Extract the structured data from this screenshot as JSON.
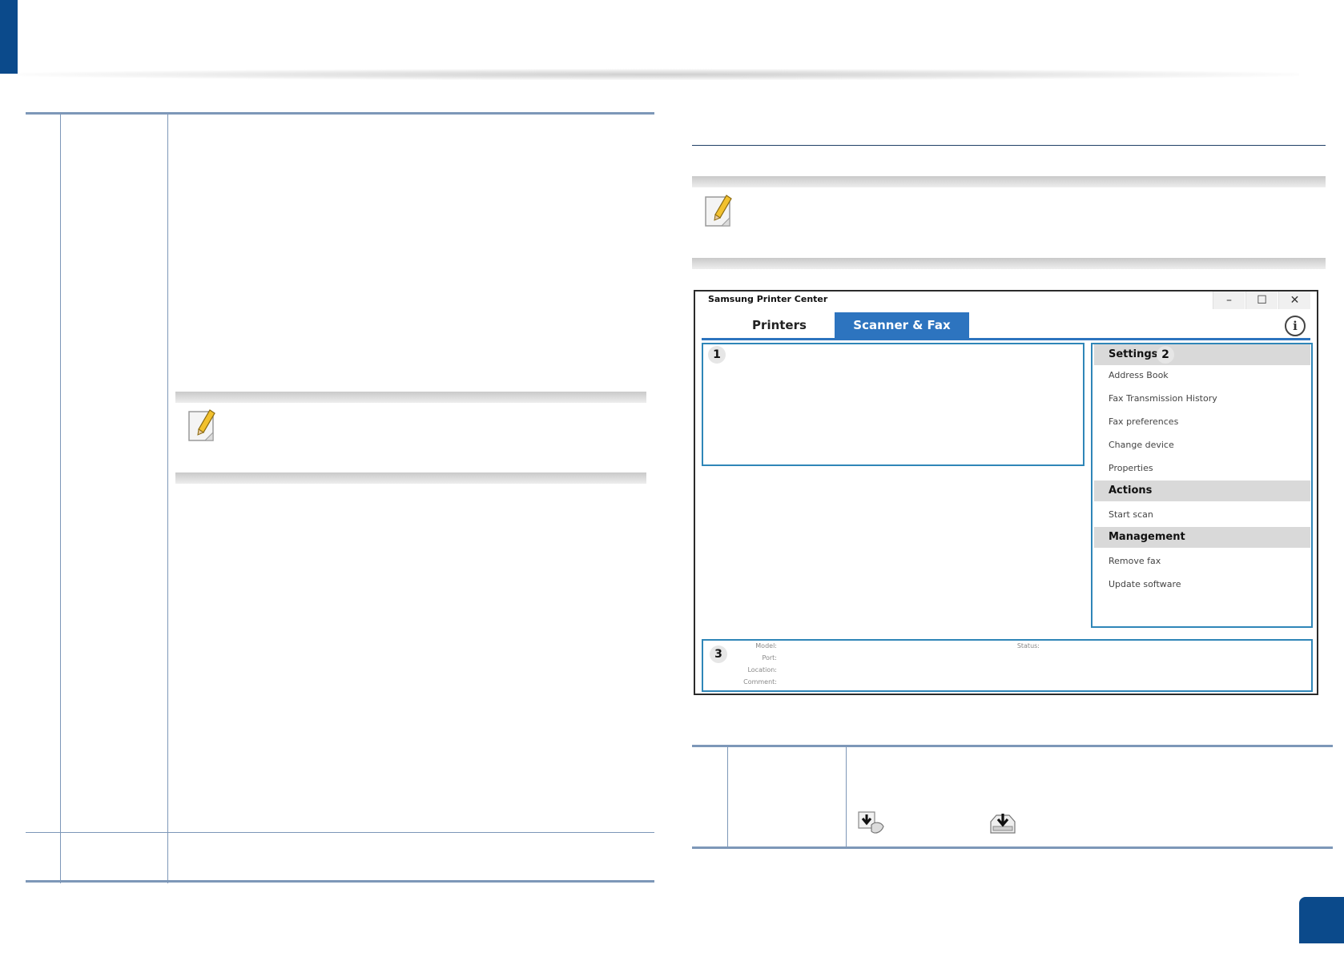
{
  "window": {
    "title": "Samsung Printer Center",
    "controls": {
      "minimize": "–",
      "maximize": "☐",
      "close": "✕"
    },
    "tabs": {
      "printers": "Printers",
      "scanner_fax": "Scanner & Fax"
    },
    "active_tab": "Scanner & Fax",
    "info_symbol": "i",
    "callouts": {
      "one": "1",
      "two": "2",
      "three": "3"
    },
    "sidebar": {
      "settings_header": "Settings",
      "settings_items": [
        "Address Book",
        "Fax Transmission History",
        "Fax preferences",
        "Change device",
        "Properties"
      ],
      "actions_header": "Actions",
      "actions_items": [
        "Start scan"
      ],
      "management_header": "Management",
      "management_items": [
        "Remove fax",
        "Update software"
      ]
    },
    "info_panel": {
      "model_label": "Model:",
      "port_label": "Port:",
      "location_label": "Location:",
      "comment_label": "Comment:",
      "status_label": "Status:"
    }
  },
  "icons": {
    "note_left": "note-pencil-icon",
    "note_right": "note-pencil-icon",
    "fax_download": "fax-download-icon",
    "scan_download": "scan-download-icon"
  },
  "colors": {
    "brand_blue": "#0b4a8b",
    "tab_active": "#2d74bf",
    "panel_border": "#2f86b8",
    "table_rule": "#7d97b8"
  }
}
